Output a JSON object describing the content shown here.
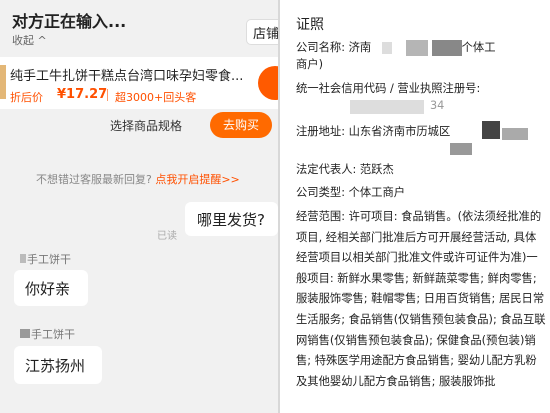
{
  "chat": {
    "title": "对方正在输入...",
    "collapse": "收起 ^",
    "shop_button": "店铺",
    "product": {
      "name": "纯手工牛扎饼干糕点台湾口味孕妇零食...",
      "price_label": "折后价",
      "price": "¥17.27",
      "repeat_customers": "超3000+回头客"
    },
    "spec_label": "选择商品规格",
    "buy_button": "去购买",
    "tip": "不想错过客服最新回复?",
    "tip_link": "点我开启提醒>>",
    "messages": [
      {
        "side": "right",
        "text": "哪里发货?",
        "status": "已读"
      },
      {
        "side": "left",
        "sender": "手工饼干",
        "text": "你好亲"
      },
      {
        "side": "left",
        "sender": "手工饼干",
        "text": "江苏扬州"
      }
    ]
  },
  "license": {
    "title": "证照",
    "company_name": "公司名称: 济南",
    "company_name_suffix": "(个体工",
    "company_name_line2": "商户)",
    "credit_code_label": "统一社会信用代码 / 营业执照注册号:",
    "credit_code_partial": "34",
    "address": "注册地址: 山东省济南市历城区",
    "legal_rep": "法定代表人: 范跃杰",
    "company_type": "公司类型: 个体工商户",
    "business_scope": "经营范围: 许可项目: 食品销售。(依法须经批准的项目, 经相关部门批准后方可开展经营活动, 具体经营项目以相关部门批准文件或许可证件为准)一般项目: 新鲜水果零售; 新鲜蔬菜零售; 鲜肉零售; 服装服饰零售; 鞋帽零售; 日用百货销售; 居民日常生活服务; 食品销售(仅销售预包装食品); 食品互联网销售(仅销售预包装食品); 保健食品(预包装)销售; 特殊医学用途配方食品销售; 婴幼儿配方乳粉及其他婴幼儿配方食品销售; 服装服饰批"
  }
}
